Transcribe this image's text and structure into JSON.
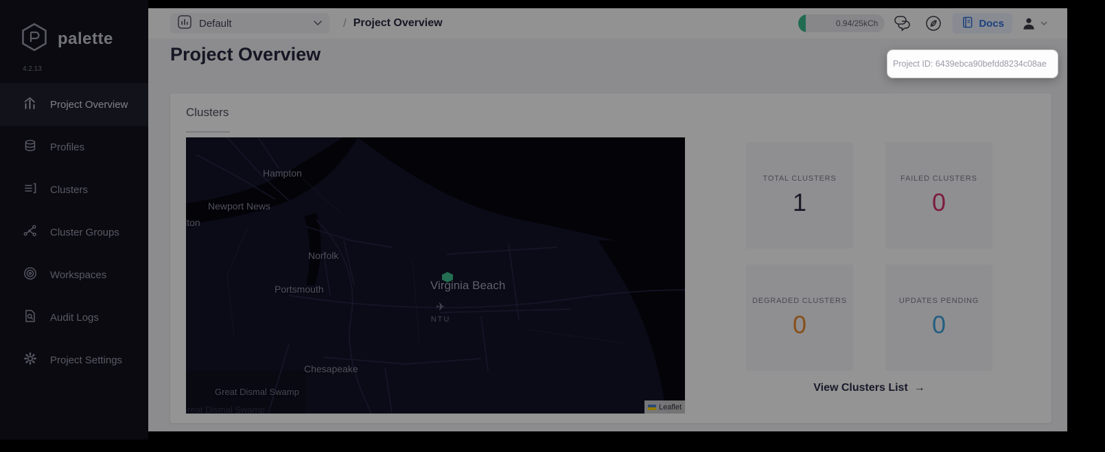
{
  "colors": {
    "accent_blue": "#2f6fd8",
    "marker_green": "#3fbf8f",
    "usage_green": "#39b88a",
    "failed_red": "#d6336c",
    "degraded_orange": "#e8892e",
    "pending_blue": "#3fa2dd"
  },
  "sidebar": {
    "brand": "palette",
    "version": "4.2.13",
    "items": [
      {
        "label": "Project Overview",
        "icon": "bar-chart-icon",
        "active": true
      },
      {
        "label": "Profiles",
        "icon": "layers-icon",
        "active": false
      },
      {
        "label": "Clusters",
        "icon": "list-icon",
        "active": false
      },
      {
        "label": "Cluster Groups",
        "icon": "network-icon",
        "active": false
      },
      {
        "label": "Workspaces",
        "icon": "concentric-icon",
        "active": false
      },
      {
        "label": "Audit Logs",
        "icon": "audit-icon",
        "active": false
      },
      {
        "label": "Project Settings",
        "icon": "gear-icon",
        "active": false
      }
    ]
  },
  "header": {
    "project_selector": {
      "value": "Default"
    },
    "breadcrumb": {
      "separator": "/",
      "current": "Project Overview"
    },
    "usage_badge": "0.94/25kCh",
    "docs_button": "Docs"
  },
  "tooltip": {
    "project_id": "Project ID: 6439ebca90befdd8234c08ae"
  },
  "page": {
    "title": "Project Overview"
  },
  "clusters": {
    "section_title": "Clusters",
    "stats": [
      {
        "label": "TOTAL CLUSTERS",
        "value": "1",
        "color": "#2b2b45"
      },
      {
        "label": "FAILED CLUSTERS",
        "value": "0",
        "color": "#d6336c"
      },
      {
        "label": "DEGRADED CLUSTERS",
        "value": "0",
        "color": "#e8892e"
      },
      {
        "label": "UPDATES PENDING",
        "value": "0",
        "color": "#3fa2dd"
      }
    ],
    "view_link": {
      "label": "View Clusters List",
      "arrow": "→"
    },
    "map": {
      "labels": [
        {
          "text": "Hampton"
        },
        {
          "text": "Newport News"
        },
        {
          "text": "llton"
        },
        {
          "text": "Norfolk"
        },
        {
          "text": "Virginia Beach"
        },
        {
          "text": "Portsmouth"
        },
        {
          "text": "Chesapeake"
        },
        {
          "text": "Great Dismal Swamp"
        },
        {
          "text": "Great Dismal Swamp"
        }
      ],
      "airport": {
        "code": "NTU",
        "plane_glyph": "✈"
      },
      "attribution": "Leaflet"
    }
  }
}
